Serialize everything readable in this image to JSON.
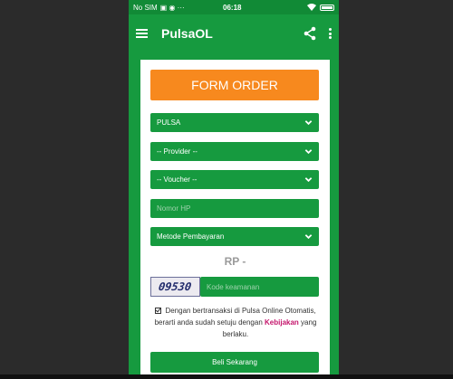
{
  "statusbar": {
    "carrier": "No SIM",
    "time": "06:18"
  },
  "appbar": {
    "title": "PulsaOL",
    "menu_icon": "hamburger-menu-icon",
    "share_icon": "share-icon",
    "overflow_icon": "more-vert-icon"
  },
  "form": {
    "title": "FORM ORDER",
    "product_select": "PULSA",
    "provider_select": "-- Provider --",
    "voucher_select": "-- Voucher --",
    "phone_placeholder": "Nomor HP",
    "payment_select": "Metode Pembayaran",
    "price": "RP -",
    "captcha_code": "09530",
    "captcha_placeholder": "Kode keamanan",
    "agree_text": "Dengan bertransaksi di Pulsa Online Otomatis, berarti anda sudah setuju dengan",
    "agree_link": "Kebijakan",
    "agree_suffix": "yang berlaku.",
    "submit_label": "Beli Sekarang"
  },
  "colors": {
    "primary": "#169a3f",
    "accent": "#f7891e",
    "link": "#c4146b"
  }
}
